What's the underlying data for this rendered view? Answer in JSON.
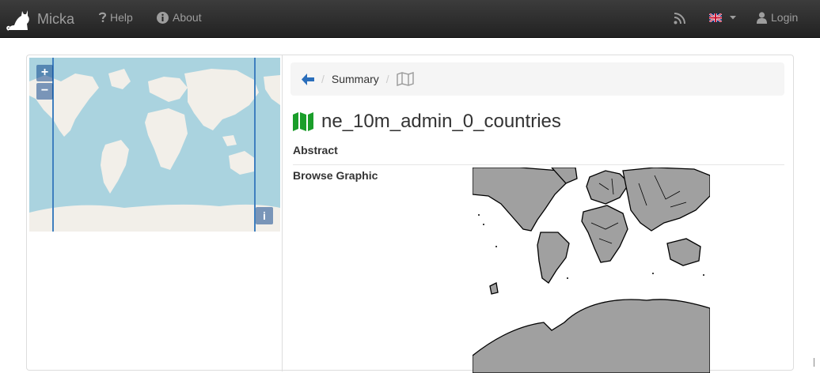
{
  "navbar": {
    "brand": "Micka",
    "help": "Help",
    "about": "About",
    "login": "Login"
  },
  "map": {
    "zoom_in": "+",
    "zoom_out": "−",
    "info": "i"
  },
  "breadcrumb": {
    "summary": "Summary",
    "sep": "/"
  },
  "record": {
    "title": "ne_10m_admin_0_countries",
    "abstract_label": "Abstract",
    "browse_label": "Browse Graphic"
  },
  "colors": {
    "ocean": "#aad3df",
    "land": "#f2efe9",
    "bbox_line": "#3f7fbf",
    "map_icon": "#1a9e2a",
    "back_arrow": "#2a6ebb",
    "browse_land": "#a0a0a0"
  }
}
